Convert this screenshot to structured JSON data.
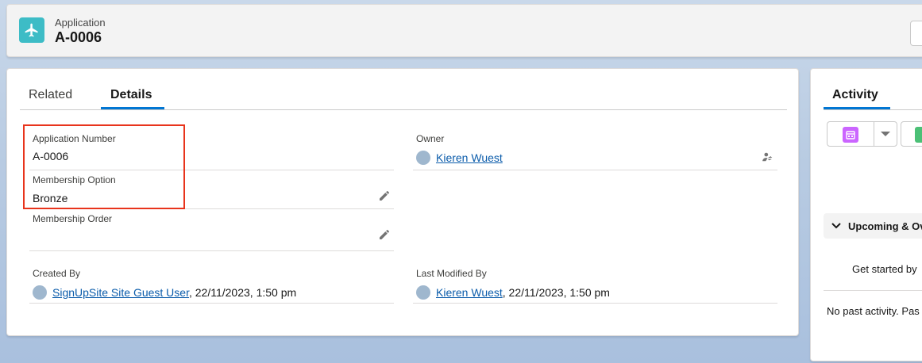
{
  "header": {
    "object_type": "Application",
    "record_name": "A-0006",
    "icon": "airplane-icon"
  },
  "tabs": [
    {
      "label": "Related",
      "active": false
    },
    {
      "label": "Details",
      "active": true
    }
  ],
  "fields": {
    "application_number": {
      "label": "Application Number",
      "value": "A-0006"
    },
    "membership_option": {
      "label": "Membership Option",
      "value": "Bronze"
    },
    "membership_order": {
      "label": "Membership Order",
      "value": ""
    },
    "owner": {
      "label": "Owner",
      "value": "Kieren Wuest"
    },
    "created_by": {
      "label": "Created By",
      "user": "SignUpSite Site Guest User",
      "date": ", 22/11/2023, 1:50 pm"
    },
    "last_modified_by": {
      "label": "Last Modified By",
      "user": "Kieren Wuest",
      "date": ", 22/11/2023, 1:50 pm"
    }
  },
  "activity": {
    "title": "Activity",
    "upcoming_label": "Upcoming & Ov",
    "get_started": "Get started by",
    "no_past": "No past activity. Pas"
  },
  "colors": {
    "accent": "#0176d3",
    "link": "#0b5cab",
    "app_icon": "#3dbcc6",
    "highlight": "#e8341c",
    "event_icon": "#cb65ff",
    "task_icon": "#4bc076"
  }
}
